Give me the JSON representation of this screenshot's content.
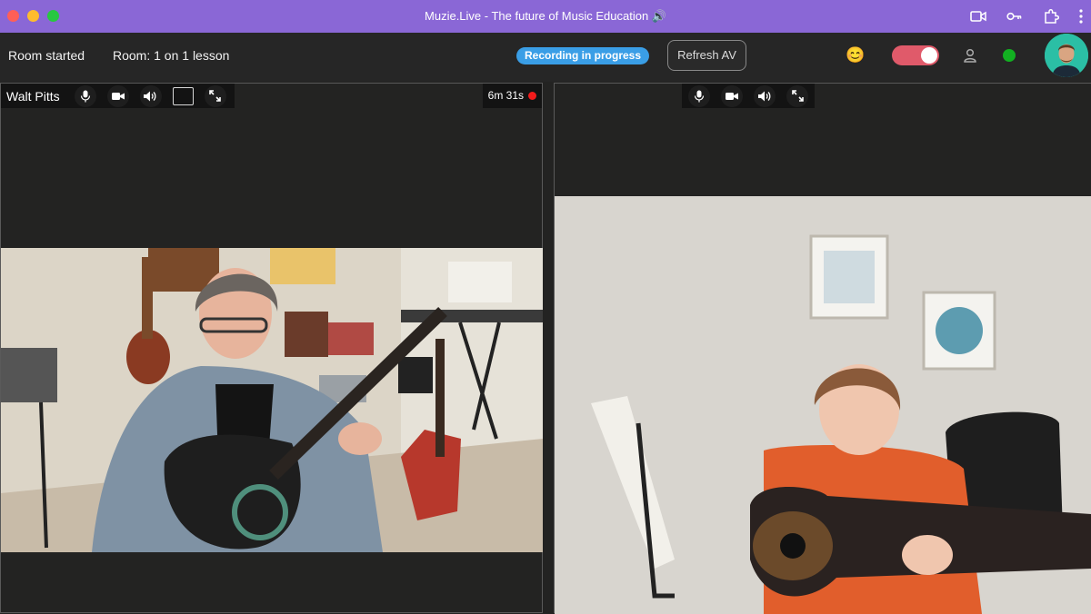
{
  "window": {
    "title": "Muzie.Live - The future of Music Education 🔊"
  },
  "browser_icons": [
    "camera-icon",
    "key-icon",
    "extension-icon",
    "more-icon"
  ],
  "toolbar": {
    "room_status": "Room started",
    "room_name": "Room: 1 on 1 lesson",
    "recording_badge": "Recording in progress",
    "refresh_label": "Refresh AV",
    "emoji": "😊"
  },
  "colors": {
    "titlebar": "#8a67d6",
    "badge": "#3a9ee6",
    "toggle": "#e05a6a",
    "status": "#12b021",
    "recording": "#f21b1b"
  },
  "left_panel": {
    "participant_name": "Walt Pitts",
    "timer": "6m 31s"
  },
  "right_panel": {}
}
